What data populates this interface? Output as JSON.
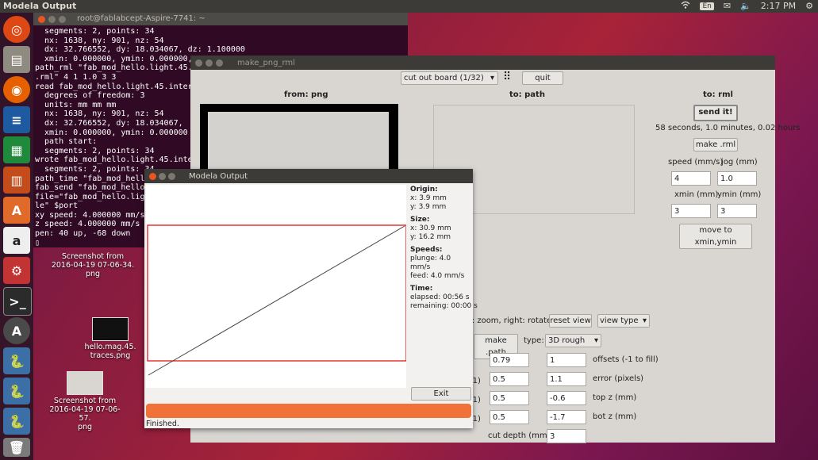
{
  "topbar": {
    "app_title": "Modela Output",
    "lang": "En",
    "clock": "2:17 PM"
  },
  "terminal": {
    "title": "root@fablabcept-Aspire-7741: ~",
    "lines": [
      "  segments: 2, points: 34",
      "  nx: 1638, ny: 901, nz: 54",
      "  dx: 32.766552, dy: 18.034067, dz: 1.100000",
      "  xmin: 0.000000, ymin: 0.000000,",
      "path_rml \"fab_mod_hello.light.45.int",
      ".rml\" 4 1 1.0 3 3",
      "read fab_mod_hello.light.45.inter",
      "  degrees of freedom: 3",
      "  units: mm mm mm",
      "  nx: 1638, ny: 901, nz: 54",
      "  dx: 32.766552, dy: 18.034067,",
      "  xmin: 0.000000, ymin: 0.000000",
      "  path start:",
      "  segments: 2, points: 34",
      "wrote fab_mod_hello.light.45.inter",
      "  segments: 2, points: 34",
      "path_time \"fab_mod_hello.",
      "fab_send \"fab_mod_hello.",
      "file=\"fab_mod_hello.ligh",
      "le\" $port",
      "xy speed: 4.000000 mm/s",
      "z speed: 4.000000 mm/s",
      "pen: 40 up, -68 down",
      "▯"
    ]
  },
  "desktop": {
    "icons": [
      {
        "label": "Screenshot from\n2016-04-19 07-06-34.\npng"
      },
      {
        "label": "hello.mag.45.\ntraces.png"
      },
      {
        "label": "Screenshot from\n2016-04-19 07-06-57.\npng"
      }
    ]
  },
  "make_png_rml": {
    "title": "make_png_rml",
    "process_select": "cut out board (1/32)",
    "quit": "quit",
    "from_png": "from: png",
    "to_path": "to: path",
    "to_rml": "to: rml",
    "send_it": "send it!",
    "time_estimate": "58 seconds, 1.0 minutes, 0.02 hours",
    "make_rml": "make .rml",
    "speed_label": "speed (mm/s)",
    "speed_value": "4",
    "jog_label": "jog (mm)",
    "jog_value": "1.0",
    "xmin_label": "xmin (mm)",
    "xmin_value": "3",
    "ymin_label": "ymin (mm)",
    "ymin_value": "3",
    "move_to": "move to xmin,ymin",
    "view_hint": "l: zoom, right: rotate",
    "reset_view": "reset view",
    "view_type": "view type",
    "make_path": "make .path",
    "type_label": "type:",
    "type_value": "3D rough",
    "rows": [
      {
        "left": "0.79",
        "mid": "1",
        "label": "offsets (-1 to fill)",
        "lpre": ""
      },
      {
        "left": "0.5",
        "mid": "1.1",
        "label": "error (pixels)",
        "lpre": "-1)"
      },
      {
        "left": "0.5",
        "mid": "-0.6",
        "label": "top z (mm)",
        "lpre": "-1)"
      },
      {
        "left": "0.5",
        "mid": "-1.7",
        "label": "bot z (mm)",
        "lpre": "-1)"
      }
    ],
    "cut_depth_label": "cut depth (mm)",
    "cut_depth_value": "3"
  },
  "modela": {
    "title": "Modela Output",
    "origin_h": "Origin:",
    "origin_x": "x: 3.9 mm",
    "origin_y": "y: 3.9 mm",
    "size_h": "Size:",
    "size_x": "x: 30.9 mm",
    "size_y": "y: 16.2 mm",
    "speeds_h": "Speeds:",
    "plunge": "plunge: 4.0 mm/s",
    "feed": "feed: 4.0 mm/s",
    "time_h": "Time:",
    "elapsed": "elapsed: 00:56 s",
    "remaining": "remaining: 00:00 s",
    "exit": "Exit",
    "progress": 1.0,
    "status": "Finished."
  },
  "colors": {
    "accent": "#e95420",
    "progress": "#f07238",
    "terminal_bg": "#300a24"
  }
}
